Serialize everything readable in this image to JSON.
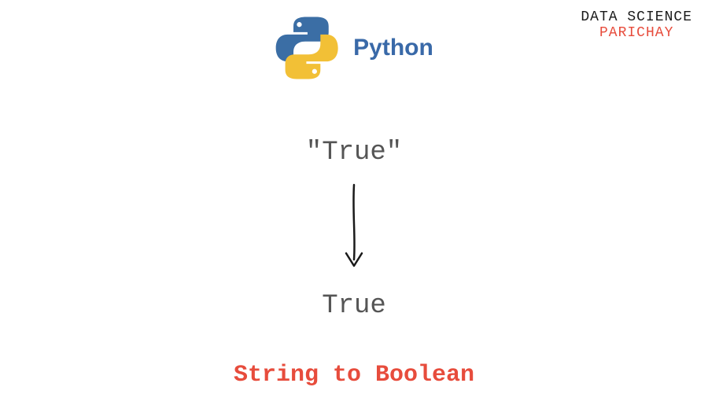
{
  "brand": {
    "line1": "DATA SCIENCE",
    "line2": "PARICHAY"
  },
  "logo": {
    "label": "Python"
  },
  "content": {
    "string_value": "\"True\"",
    "bool_value": "True",
    "caption": "String to Boolean"
  }
}
